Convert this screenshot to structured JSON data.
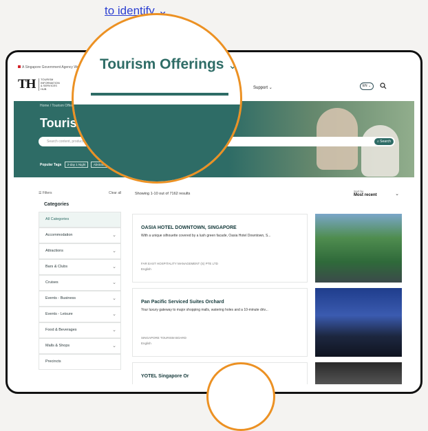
{
  "top_link": {
    "label": "to identify"
  },
  "page": {
    "sg_bar": "A Singapore Government Agency Website",
    "logo": {
      "mark": "TH",
      "text": "TOURISM INFORMATION & SERVICES HUB"
    },
    "nav": {
      "services": "ces",
      "support": "Support"
    },
    "lang_button": "EN",
    "hero": {
      "breadcrumb": "Home  /  Tourism Offerings",
      "title": "Tourism",
      "search_placeholder": "Search content, products",
      "search_button": "Search",
      "popular_tags_label": "Popular Tags",
      "tags": [
        "2-day 1 Night",
        "Abstract",
        "Aerial View",
        "Attractions"
      ]
    },
    "filters": {
      "header": "Filters",
      "clear_all": "Clear all",
      "categories_title": "Categories",
      "items": [
        "All Categories",
        "Accommodation",
        "Attractions",
        "Bars & Clubs",
        "Cruises",
        "Events - Business",
        "Events - Leisure",
        "Food & Beverages",
        "Malls & Shops",
        "Precincts"
      ]
    },
    "results": {
      "count": "Showing 1-10 out of 7162 results",
      "sort_label": "Sort by",
      "sort_value": "Most recent",
      "cards": [
        {
          "title": "OASIA HOTEL DOWNTOWN, SINGAPORE",
          "desc": "With a unique silhouette covered by a lush green facade, Oasia Hotel Downtown, S...",
          "org": "FAR EAST HOSPITALITY MANAGEMENT (S) PTE LTD",
          "lang": "English"
        },
        {
          "title": "Pan Pacific Serviced Suites Orchard",
          "desc": "Your luxury gateway to major shopping malls, watering holes and a 10-minute driv...",
          "org": "SINGAPORE TOURISM BOARD",
          "lang": "English"
        },
        {
          "title": "YOTEL Singapore Or",
          "desc": "",
          "org": "",
          "lang": ""
        }
      ]
    }
  },
  "magnifier": {
    "label": "Tourism Offerings"
  },
  "colors": {
    "teal": "#2e6c66",
    "accent_ring": "#ec9123",
    "link_blue": "#2c3fd1"
  }
}
